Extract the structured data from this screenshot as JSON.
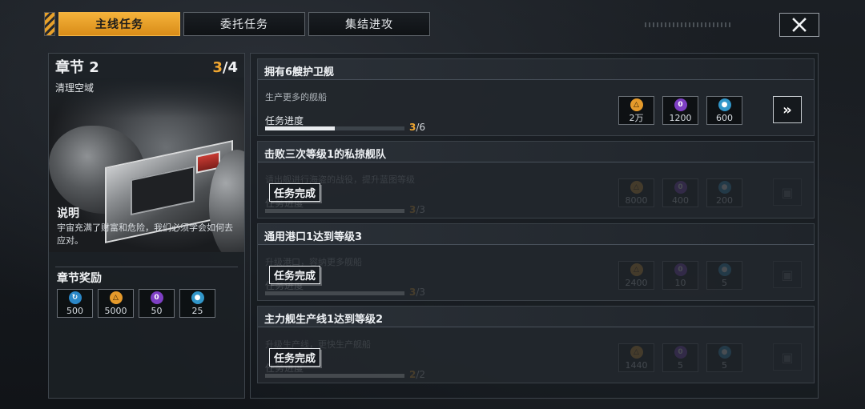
{
  "tabs": [
    {
      "label": "主线任务",
      "active": true
    },
    {
      "label": "委托任务",
      "active": false
    },
    {
      "label": "集结进攻",
      "active": false
    }
  ],
  "close_icon": "close-icon",
  "chapter": {
    "title": "章节 2",
    "current": "3",
    "total": "/4",
    "subtitle": "清理空域",
    "desc_title": "说明",
    "desc_text": "宇宙充满了财富和危险，我们必须学会如何去应对。",
    "rewards_title": "章节奖励",
    "rewards": [
      {
        "icon": "refresh-icon",
        "value": "500"
      },
      {
        "icon": "triangle-resource-icon",
        "value": "5000"
      },
      {
        "icon": "crystal-resource-icon",
        "value": "50"
      },
      {
        "icon": "blue-gem-icon",
        "value": "25"
      }
    ]
  },
  "quests": [
    {
      "title": "拥有6艘护卫舰",
      "desc": "生产更多的舰船",
      "progress_label": "任务进度",
      "progress_current": "3",
      "progress_total": "/6",
      "progress_fraction": 0.5,
      "completed": false,
      "rewards": [
        "2万",
        "1200",
        "600"
      ],
      "action": "go-button"
    },
    {
      "title": "击败三次等级1的私掠舰队",
      "desc": "请出舰进行海盗的战役，提升蓝图等级",
      "progress_label": "任务进度",
      "progress_current": "3",
      "progress_total": "/3",
      "progress_fraction": 1.0,
      "completed": true,
      "stamp": "任务完成",
      "rewards": [
        "8000",
        "400",
        "200"
      ]
    },
    {
      "title": "通用港口1达到等级3",
      "desc": "升级港口，容纳更多舰船",
      "progress_label": "任务进度",
      "progress_current": "3",
      "progress_total": "/3",
      "progress_fraction": 1.0,
      "completed": true,
      "stamp": "任务完成",
      "rewards": [
        "2400",
        "10",
        "5"
      ]
    },
    {
      "title": "主力舰生产线1达到等级2",
      "desc": "升级生产线，更快生产舰船",
      "progress_label": "任务进度",
      "progress_current": "2",
      "progress_total": "/2",
      "progress_fraction": 1.0,
      "completed": true,
      "stamp": "任务完成",
      "rewards": [
        "1440",
        "5",
        "5"
      ]
    }
  ]
}
